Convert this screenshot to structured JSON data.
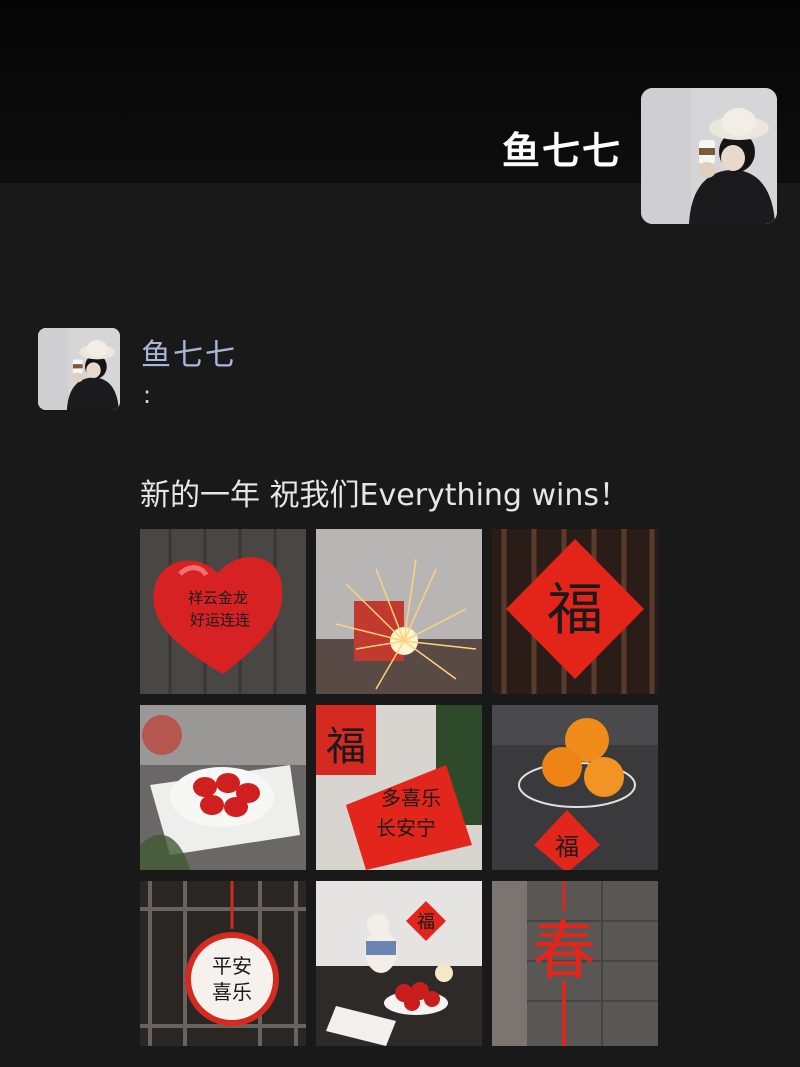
{
  "profile": {
    "name": "鱼七七"
  },
  "post": {
    "author": "鱼七七",
    "colon": ":",
    "text": "新的一年 祝我们Everything wins！"
  },
  "photos": [
    {
      "name": "heart-balloon"
    },
    {
      "name": "sparkler"
    },
    {
      "name": "fu-window"
    },
    {
      "name": "strawberries-plate"
    },
    {
      "name": "fu-couplet-papers"
    },
    {
      "name": "oranges-basket"
    },
    {
      "name": "pingan-xile-ornament"
    },
    {
      "name": "duck-strawberries"
    },
    {
      "name": "chun-decoration"
    }
  ],
  "glyphs": {
    "fu": "福",
    "chun": "春",
    "couplet": [
      "多喜乐",
      "长安宁"
    ],
    "pingan": [
      "平安",
      "喜乐"
    ],
    "balloon": [
      "祥云金龙",
      "好运连连"
    ]
  },
  "colors": {
    "background": "#191919",
    "name_link": "#a8b5d6",
    "festive_red": "#d91e18"
  }
}
